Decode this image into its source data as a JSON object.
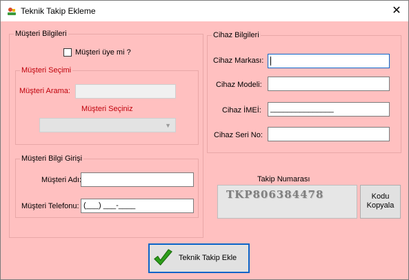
{
  "window": {
    "title": "Teknik Takip Ekleme",
    "close_glyph": "✕"
  },
  "customer_info": {
    "legend": "Müşteri Bilgileri",
    "member_checkbox_label": "Müşteri üye mi ?",
    "member_checked": false,
    "selection": {
      "legend": "Müşteri Seçimi",
      "search_label": "Müşteri Arama:",
      "search_value": "",
      "select_label": "Müşteri Seçiniz",
      "select_value": ""
    },
    "entry": {
      "legend": "Müşteri Bilgi Girişi",
      "name_label": "Müşteri Adı:",
      "name_value": "",
      "phone_label": "Müşteri Telefonu:",
      "phone_value": "(___) ___-____"
    }
  },
  "device_info": {
    "legend": "Cihaz Bilgileri",
    "brand_label": "Cihaz Markası:",
    "brand_value": "",
    "model_label": "Cihaz Modeli:",
    "model_value": "",
    "imei_label": "Cihaz İMEİ:",
    "imei_value": "_______________",
    "serial_label": "Cihaz Seri No:",
    "serial_value": ""
  },
  "tracking": {
    "label": "Takip Numarası",
    "number": "TKP806384478",
    "copy_line1": "Kodu",
    "copy_line2": "Kopyala"
  },
  "actions": {
    "add_label": "Teknik Takip Ekle"
  },
  "icons": {
    "app": "app-icon",
    "check": "checkmark-icon",
    "chevron": "chevron-down-icon"
  },
  "colors": {
    "background": "#ffc0c0",
    "label_red": "#c0000a",
    "check_green": "#2e9e1a"
  }
}
